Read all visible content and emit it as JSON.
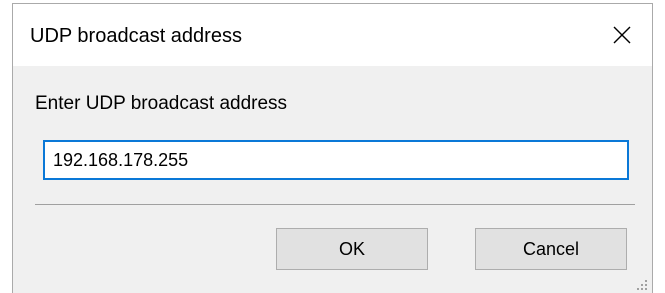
{
  "window": {
    "title": "UDP broadcast address"
  },
  "form": {
    "prompt": "Enter UDP broadcast address",
    "address_value": "192.168.178.255"
  },
  "buttons": {
    "ok_label": "OK",
    "cancel_label": "Cancel"
  },
  "icons": {
    "close": "close-icon",
    "resize_grip": "resize-grip-icon"
  },
  "colors": {
    "input_focus_border": "#0a78d7",
    "dialog_background": "#f0f0f0",
    "button_background": "#e1e1e1"
  }
}
